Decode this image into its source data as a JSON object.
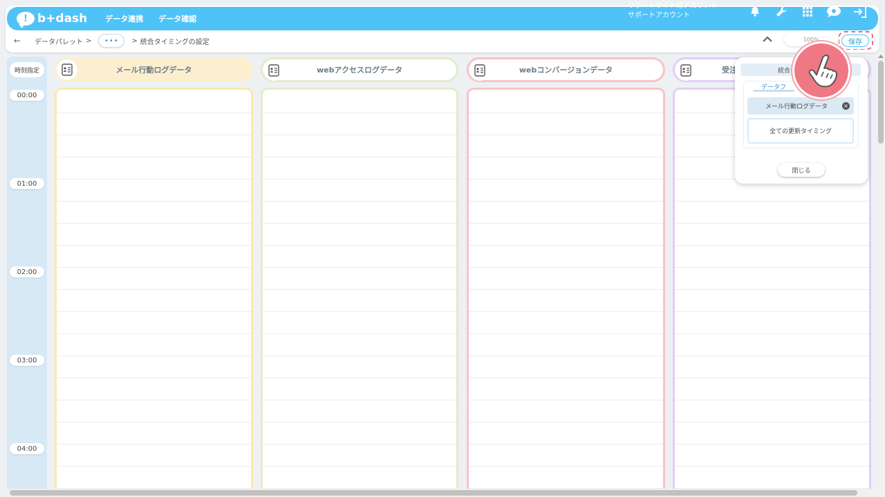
{
  "header": {
    "logo_text": "b+dash",
    "nav": [
      "データ連携",
      "データ確認"
    ],
    "account_line1": "サポートサイト用アカウント",
    "account_line2": "サポートアカウント",
    "icons": [
      "bell-icon",
      "wrench-icon",
      "grid-icon",
      "chat-bubble-icon",
      "logout-icon"
    ]
  },
  "breadcrumb": {
    "back": "←",
    "first": "データパレット",
    "sep": ">",
    "more": "•••",
    "current": "統合タイミングの設定"
  },
  "toolbar": {
    "zoom": "100%",
    "save_label": "保存"
  },
  "time_column": {
    "header": "時刻指定",
    "labels": [
      "00:00",
      "01:00",
      "02:00",
      "03:00",
      "04:00"
    ]
  },
  "columns": [
    {
      "label": "メール行動ログデータ",
      "color": "#fbe9a8"
    },
    {
      "label": "webアクセスログデータ",
      "color": "#e4ebc9"
    },
    {
      "label": "webコンバージョンデータ",
      "color": "#f8c3c3"
    },
    {
      "label": "受注",
      "color": "#e4cdf5"
    }
  ],
  "popup": {
    "title": "統合",
    "sub_label": "データフ",
    "chip_label": "メール行動ログデータ",
    "timing_option": "全ての更新タイミング",
    "close_label": "閉じる"
  },
  "colors": {
    "accent": "#4fc3f7",
    "highlight": "#f06b7a"
  }
}
